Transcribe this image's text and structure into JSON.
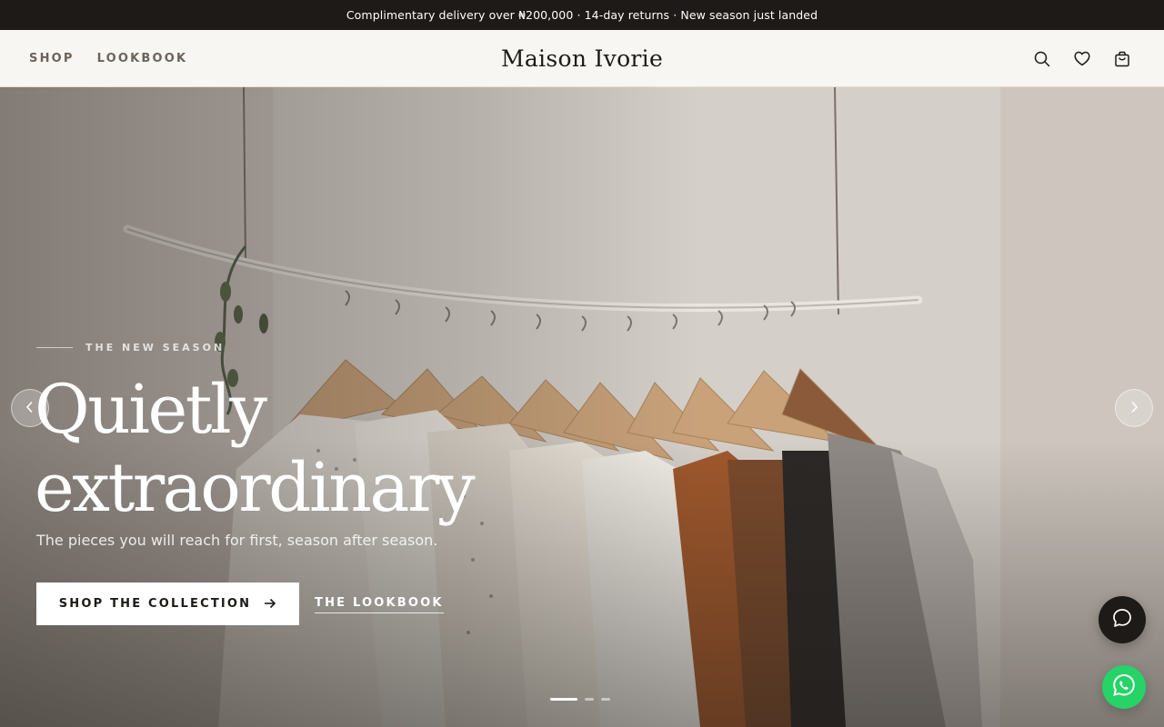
{
  "announcement": "Complimentary delivery over ₦200,000 · 14-day returns · New season just landed",
  "nav": {
    "shop": "SHOP",
    "lookbook": "LOOKBOOK"
  },
  "brand": "Maison Ivorie",
  "header_icons": [
    "search-icon",
    "heart-icon",
    "bag-icon"
  ],
  "hero": {
    "eyebrow": "THE NEW SEASON",
    "headline_line1": "Quietly",
    "headline_line2": "extraordinary",
    "subtitle": "The pieces you will reach for first, season after season.",
    "cta_label": "SHOP THE COLLECTION",
    "secondary_link": "THE LOOKBOOK",
    "slides_total": 3,
    "active_slide": 1
  },
  "floating": {
    "chat": "chat-icon",
    "whatsapp": "whatsapp-icon"
  },
  "colors": {
    "dark": "#1d1a17",
    "background": "#f8f6f2",
    "whatsapp": "#25d366"
  }
}
